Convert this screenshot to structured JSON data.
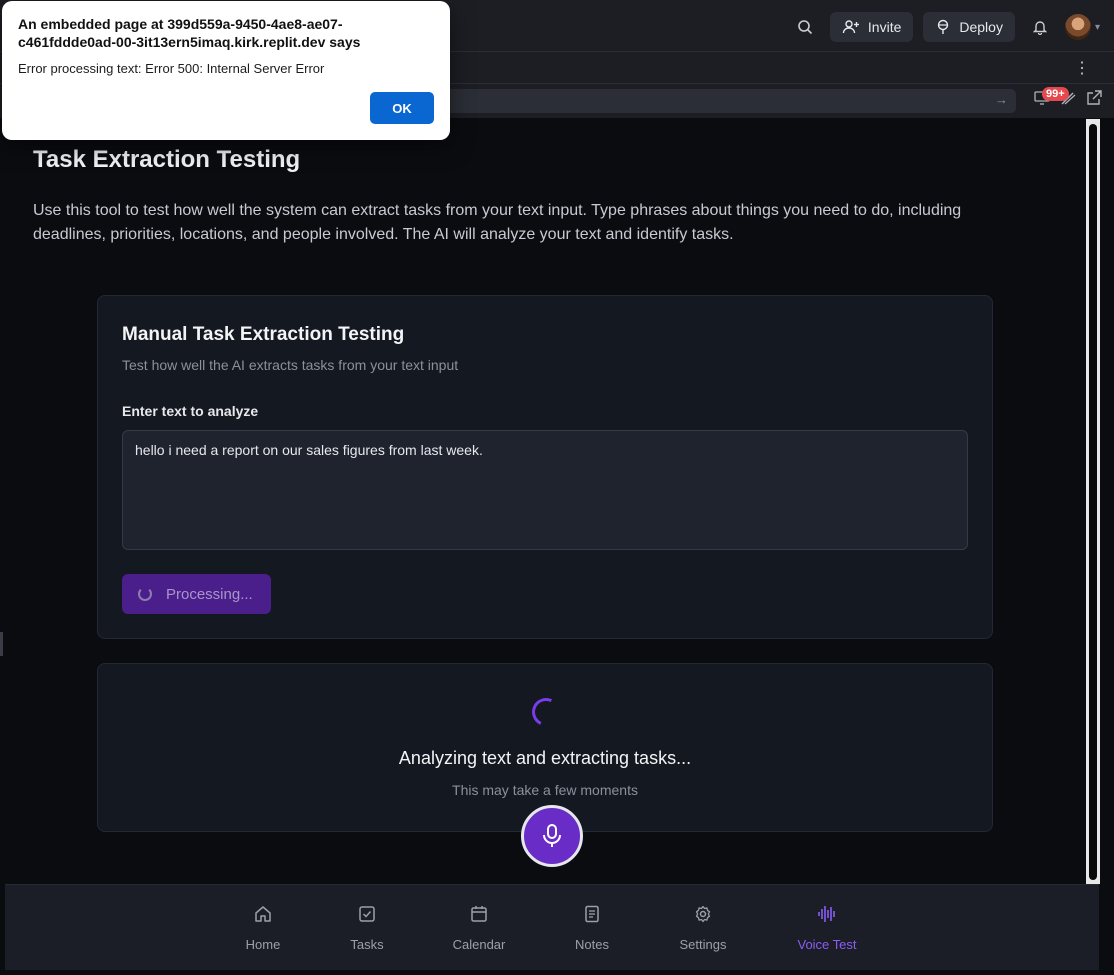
{
  "chrome": {
    "invite_label": "Invite",
    "deploy_label": "Deploy",
    "notification_badge": "99+"
  },
  "page": {
    "title": "Task Extraction Testing",
    "description": "Use this tool to test how well the system can extract tasks from your text input. Type phrases about things you need to do, including deadlines, priorities, locations, and people involved. The AI will analyze your text and identify tasks."
  },
  "manual_card": {
    "title": "Manual Task Extraction Testing",
    "subtitle": "Test how well the AI extracts tasks from your text input",
    "field_label": "Enter text to analyze",
    "input_value": "hello i need a report on our sales figures from last week.",
    "button_label": "Processing..."
  },
  "analyzing_card": {
    "title": "Analyzing text and extracting tasks...",
    "subtitle": "This may take a few moments"
  },
  "bottom_nav": {
    "items": [
      {
        "label": "Home",
        "icon": "home-icon"
      },
      {
        "label": "Tasks",
        "icon": "check-square-icon"
      },
      {
        "label": "Calendar",
        "icon": "calendar-icon"
      },
      {
        "label": "Notes",
        "icon": "notes-icon"
      },
      {
        "label": "Settings",
        "icon": "gear-icon"
      },
      {
        "label": "Voice Test",
        "icon": "waveform-icon",
        "active": true
      }
    ]
  },
  "dialog": {
    "title": "An embedded page at 399d559a-9450-4ae8-ae07-c461fddde0ad-00-3it13ern5imaq.kirk.replit.dev says",
    "message": "Error processing text: Error 500: Internal Server Error",
    "ok_label": "OK"
  },
  "colors": {
    "accent": "#8b5cf6",
    "button_bg": "#4a1f8c",
    "ok_blue": "#0a66d0"
  }
}
